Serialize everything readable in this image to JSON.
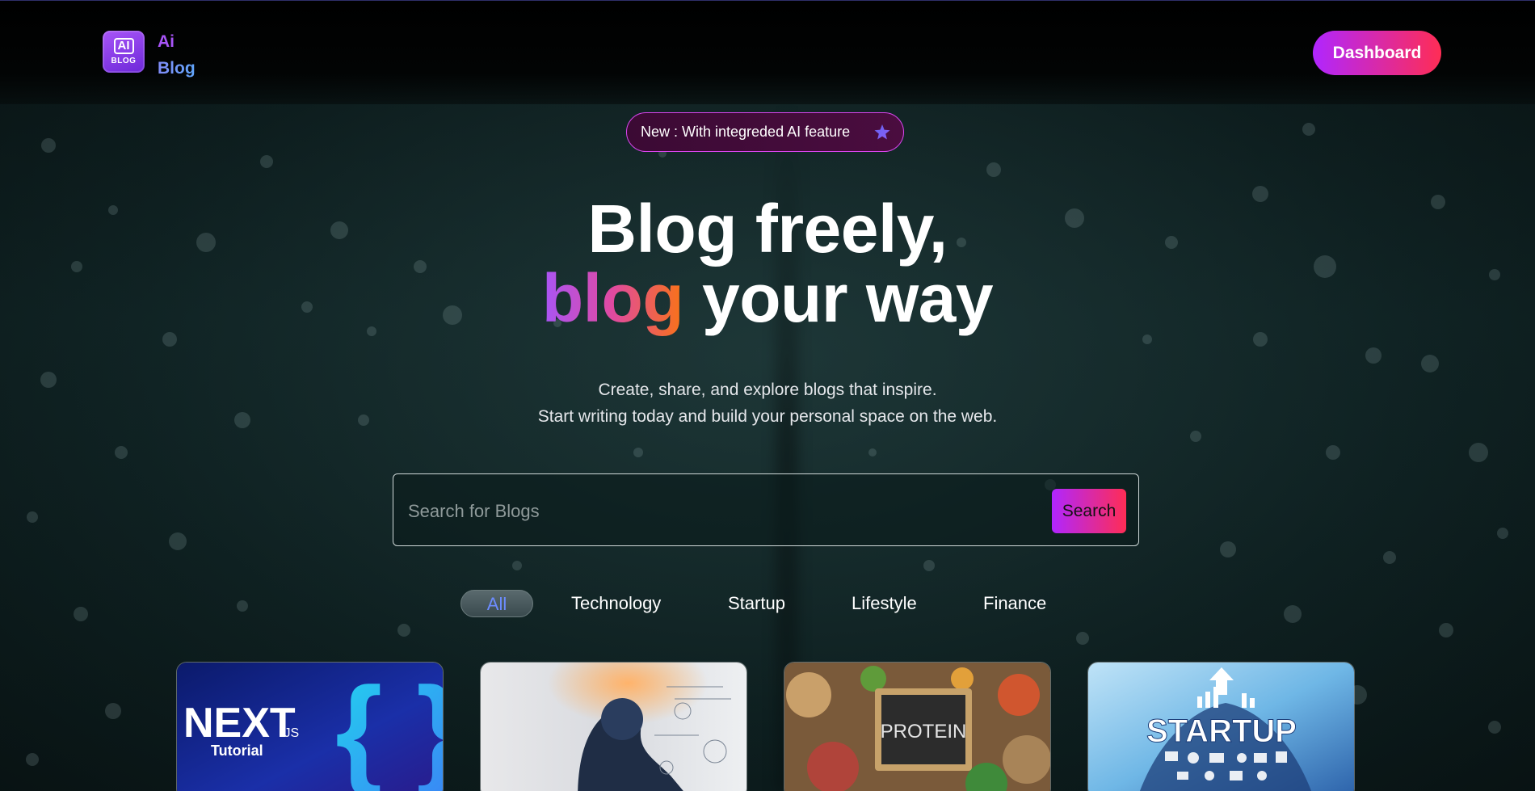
{
  "header": {
    "logo_top": "AI",
    "logo_bottom": "BLOG",
    "brand_line1": "Ai",
    "brand_line2": "Blog",
    "dashboard_label": "Dashboard"
  },
  "announcement": {
    "text": "New : With integreded AI feature",
    "icon": "star-icon"
  },
  "hero": {
    "title_line1": "Blog freely,",
    "title_gradient_word": "blog",
    "title_line2_rest": " your way",
    "subtitle_line1": "Create, share, and explore blogs that inspire.",
    "subtitle_line2": "Start writing today and build your personal space on the web."
  },
  "search": {
    "placeholder": "Search for Blogs",
    "value": "",
    "button_label": "Search"
  },
  "categories": {
    "items": [
      "All",
      "Technology",
      "Startup",
      "Lifestyle",
      "Finance"
    ],
    "active": "All"
  },
  "cards": [
    {
      "image_text_1": "NEXT",
      "image_text_2": ".JS",
      "image_text_3": "Tutorial"
    },
    {
      "image_text_1": ""
    },
    {
      "image_text_1": "PROTEIN"
    },
    {
      "image_text_1": "STARTUP"
    }
  ],
  "colors": {
    "accent_gradient_start": "#b026ff",
    "accent_gradient_end": "#ff2d55",
    "brand_purple": "#a855f7",
    "brand_blue": "#60a5fa",
    "active_tab_text": "#6d8cff"
  }
}
